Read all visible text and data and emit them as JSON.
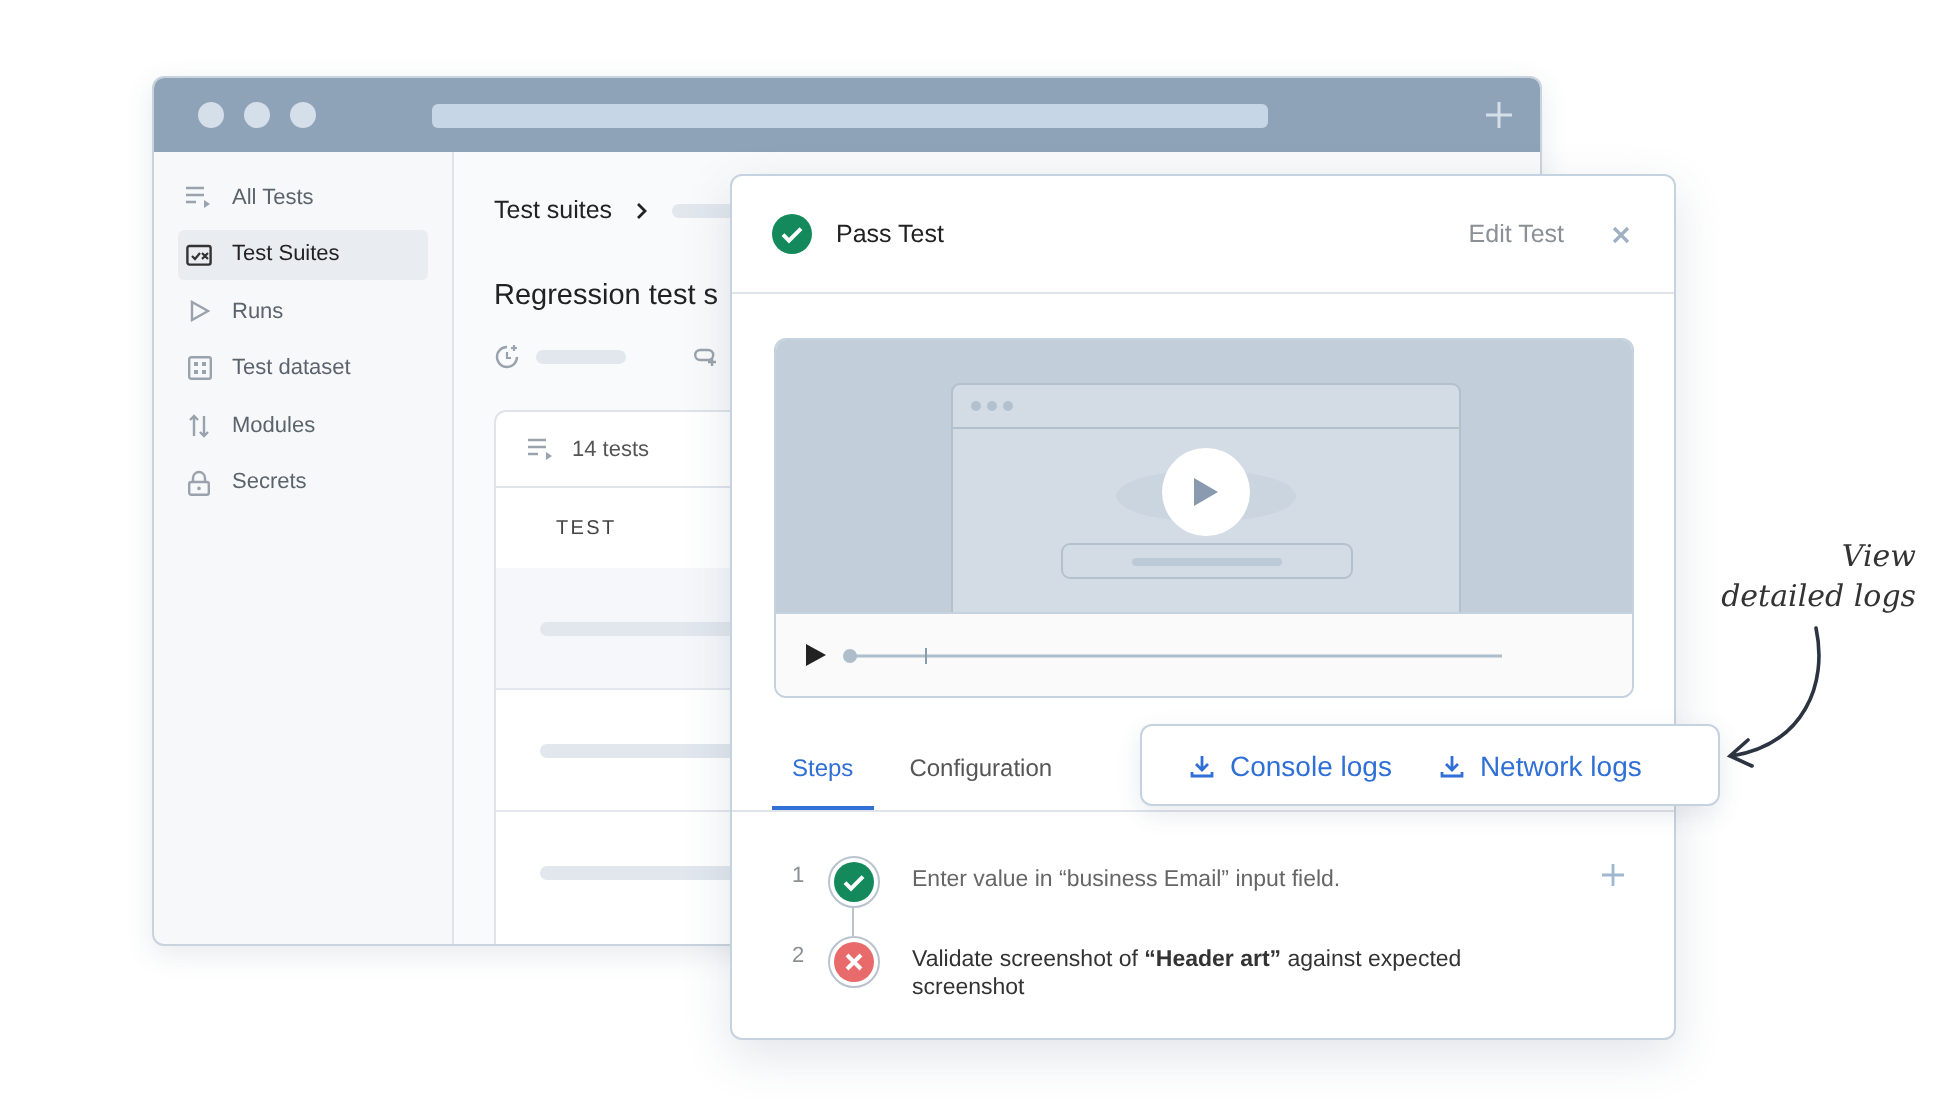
{
  "sidebar": {
    "items": [
      {
        "label": "All Tests",
        "selected": false
      },
      {
        "label": "Test Suites",
        "selected": true
      },
      {
        "label": "Runs",
        "selected": false
      },
      {
        "label": "Test dataset",
        "selected": false
      },
      {
        "label": "Modules",
        "selected": false
      },
      {
        "label": "Secrets",
        "selected": false
      }
    ]
  },
  "main": {
    "breadcrumb": "Test suites",
    "heading": "Regression test s",
    "table": {
      "count": "14 tests",
      "columns": [
        "TEST"
      ]
    }
  },
  "dialog": {
    "kind": "pass",
    "title": "Pass Test",
    "edit": "Edit Test",
    "tabs": [
      {
        "label": "Steps",
        "selected": true
      },
      {
        "label": "Configuration",
        "selected": false
      }
    ],
    "steps": [
      {
        "number": "1",
        "kind": "pass",
        "text": "Enter value in “business Email” input field."
      },
      {
        "number": "2",
        "kind": "fail",
        "text": "Validate screenshot of **“Header art”** against expected screenshot"
      }
    ]
  },
  "log_buttons": [
    "Console logs",
    "Network logs"
  ],
  "annotation": {
    "lines": [
      "View",
      "detailed logs"
    ]
  }
}
